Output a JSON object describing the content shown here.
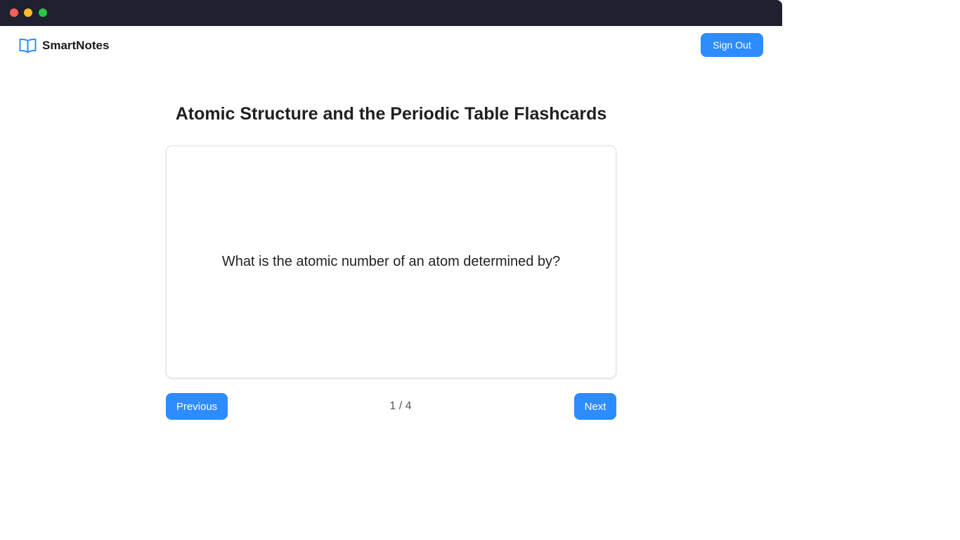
{
  "app": {
    "brand_name": "SmartNotes",
    "brand_icon": "open-book-icon",
    "accent_color": "#2d8cff"
  },
  "navbar": {
    "sign_out_label": "Sign Out"
  },
  "deck": {
    "title": "Atomic Structure and the Periodic Table Flashcards",
    "current_card": {
      "text": "What is the atomic number of an atom determined by?"
    },
    "counter": "1 / 4",
    "previous_label": "Previous",
    "next_label": "Next"
  }
}
